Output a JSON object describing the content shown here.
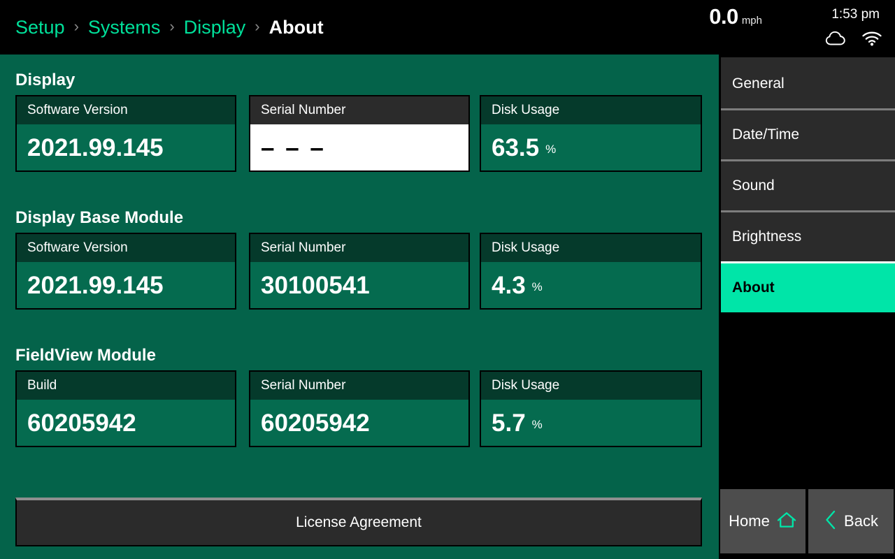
{
  "statusbar": {
    "speed_value": "0.0",
    "speed_unit": "mph",
    "time": "1:53 pm",
    "icons": [
      "cloud-icon",
      "wifi-icon"
    ]
  },
  "breadcrumb": {
    "separator": "›",
    "items": [
      {
        "label": "Setup",
        "current": false
      },
      {
        "label": "Systems",
        "current": false
      },
      {
        "label": "Display",
        "current": false
      },
      {
        "label": "About",
        "current": true
      }
    ]
  },
  "sections": [
    {
      "title": "Display",
      "cards": [
        {
          "label": "Software Version",
          "value": "2021.99.145",
          "suffix": "",
          "selected": false
        },
        {
          "label": "Serial Number",
          "value": "– – –",
          "suffix": "",
          "selected": true
        },
        {
          "label": "Disk Usage",
          "value": "63.5",
          "suffix": "%",
          "selected": false
        }
      ]
    },
    {
      "title": "Display Base Module",
      "cards": [
        {
          "label": "Software Version",
          "value": "2021.99.145",
          "suffix": "",
          "selected": false
        },
        {
          "label": "Serial Number",
          "value": "30100541",
          "suffix": "",
          "selected": false
        },
        {
          "label": "Disk Usage",
          "value": "4.3",
          "suffix": "%",
          "selected": false
        }
      ]
    },
    {
      "title": "FieldView Module",
      "cards": [
        {
          "label": "Build",
          "value": "60205942",
          "suffix": "",
          "selected": false
        },
        {
          "label": "Serial Number",
          "value": "60205942",
          "suffix": "",
          "selected": false
        },
        {
          "label": "Disk Usage",
          "value": "5.7",
          "suffix": "%",
          "selected": false
        }
      ]
    }
  ],
  "license_button": {
    "label": "License Agreement"
  },
  "sidebar": {
    "items": [
      {
        "label": "General",
        "active": false
      },
      {
        "label": "Date/Time",
        "active": false
      },
      {
        "label": "Sound",
        "active": false
      },
      {
        "label": "Brightness",
        "active": false
      },
      {
        "label": "About",
        "active": true
      }
    ]
  },
  "bottom_nav": [
    {
      "label": "Home",
      "icon": "home-icon"
    },
    {
      "label": "Back",
      "icon": "chevron-left-icon"
    }
  ],
  "colors": {
    "accent_green": "#00e09a",
    "active_teal": "#00e5a8",
    "content_green": "#04634a",
    "card_body_green": "#056b4f",
    "card_head_green": "#053a2b",
    "panel_dark": "#2b2b2b",
    "black": "#000000"
  }
}
